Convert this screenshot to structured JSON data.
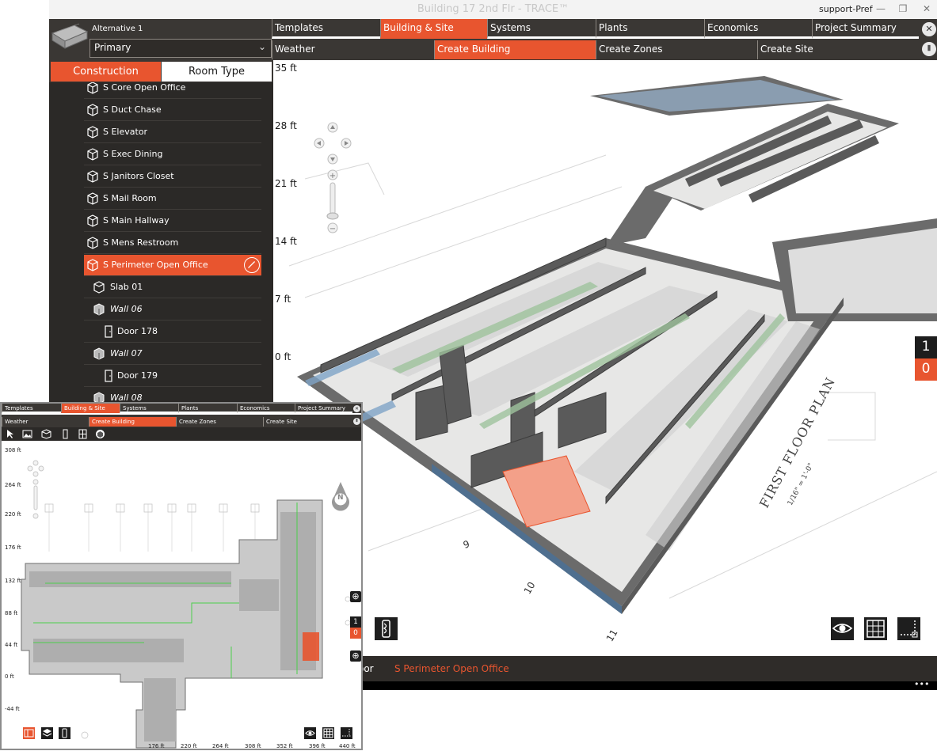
{
  "window": {
    "title": "Building 17 2nd Flr - TRACE™",
    "user": "support-Pref",
    "minimize": "—",
    "maximize": "❐",
    "close": "✕"
  },
  "alternative": {
    "label": "Alternative 1",
    "selected": "Primary"
  },
  "main_tabs": [
    {
      "label": "Templates",
      "active": false
    },
    {
      "label": "Building & Site",
      "active": true
    },
    {
      "label": "Systems",
      "active": false
    },
    {
      "label": "Plants",
      "active": false
    },
    {
      "label": "Economics",
      "active": false
    },
    {
      "label": "Project Summary",
      "active": false
    }
  ],
  "sub_tabs": [
    {
      "label": "Weather",
      "active": false
    },
    {
      "label": "Create Building",
      "active": true
    },
    {
      "label": "Create Zones",
      "active": false
    },
    {
      "label": "Create Site",
      "active": false
    }
  ],
  "side_tabs": {
    "construction": "Construction",
    "room_type": "Room Type"
  },
  "tree": [
    {
      "label": "S Core Open Office",
      "type": "room",
      "indent": 0
    },
    {
      "label": "S Duct Chase",
      "type": "room",
      "indent": 0
    },
    {
      "label": "S Elevator",
      "type": "room",
      "indent": 0
    },
    {
      "label": "S Exec Dining",
      "type": "room",
      "indent": 0
    },
    {
      "label": "S Janitors Closet",
      "type": "room",
      "indent": 0
    },
    {
      "label": "S Mail Room",
      "type": "room",
      "indent": 0
    },
    {
      "label": "S Main Hallway",
      "type": "room",
      "indent": 0
    },
    {
      "label": "S Mens Restroom",
      "type": "room",
      "indent": 0
    },
    {
      "label": "S Perimeter Open Office",
      "type": "room",
      "indent": 0,
      "selected": true
    },
    {
      "label": "Slab 01",
      "type": "slab",
      "indent": 1
    },
    {
      "label": "Wall 06",
      "type": "wall",
      "indent": 1
    },
    {
      "label": "Door 178",
      "type": "door",
      "indent": 2
    },
    {
      "label": "Wall 07",
      "type": "wall",
      "indent": 1
    },
    {
      "label": "Door 179",
      "type": "door",
      "indent": 2
    },
    {
      "label": "Wall 08",
      "type": "wall",
      "indent": 1
    }
  ],
  "height_labels": [
    "35 ft",
    "28 ft",
    "21 ft",
    "14 ft",
    "7 ft",
    "0 ft"
  ],
  "story": {
    "upper": "1",
    "lower": "0"
  },
  "breadcrumb": {
    "prev": "oor",
    "current": "S Perimeter Open Office"
  },
  "more": "•••",
  "plan_text": {
    "title": "FIRST FLOOR PLAN",
    "scale": "1/16\" = 1'-0\"",
    "grid_marks": [
      "9",
      "10",
      "11"
    ]
  },
  "small": {
    "tabs": [
      "Templates",
      "Building & Site",
      "Systems",
      "Plants",
      "Economics",
      "Project Summary"
    ],
    "sub_tabs": [
      "Weather",
      "Create Building",
      "Create Zones",
      "Create Site"
    ],
    "y_labels": [
      "308 ft",
      "264 ft",
      "220 ft",
      "176 ft",
      "132 ft",
      "88 ft",
      "44 ft",
      "0 ft",
      "-44 ft"
    ],
    "x_labels": [
      "176 ft",
      "220 ft",
      "264 ft",
      "308 ft",
      "352 ft",
      "396 ft",
      "440 ft"
    ],
    "story": {
      "upper": "1",
      "lower": "0"
    },
    "north": "N"
  },
  "colors": {
    "accent": "#e8552f",
    "dark": "#2b2927",
    "bar": "#3a3734"
  }
}
